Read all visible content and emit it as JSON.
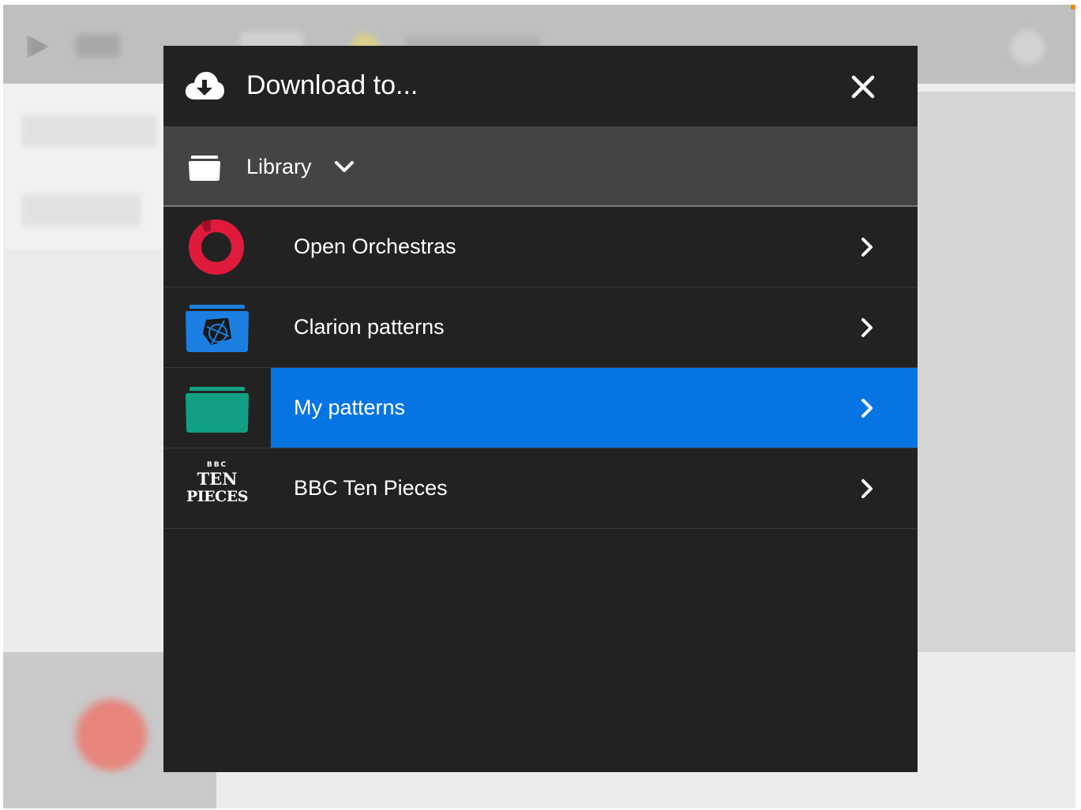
{
  "dialog": {
    "title": "Download to...",
    "header_icon": "cloud-download-icon",
    "close_icon": "close-icon",
    "location": {
      "label": "Library",
      "icon": "folder-icon",
      "dropdown_icon": "chevron-down-icon"
    },
    "items": [
      {
        "label": "Open Orchestras",
        "icon": "open-orchestras-logo",
        "selected": false
      },
      {
        "label": "Clarion patterns",
        "icon": "clarion-folder-icon",
        "selected": false
      },
      {
        "label": "My patterns",
        "icon": "green-folder-icon",
        "selected": true
      },
      {
        "label": "BBC Ten Pieces",
        "icon": "bbc-ten-pieces-logo",
        "selected": false,
        "logo_text": [
          "BBC",
          "TEN",
          "PIECES"
        ]
      }
    ]
  },
  "colors": {
    "dialog_bg": "#222222",
    "location_bar_bg": "#444444",
    "selected_bg": "#0774e3",
    "open_orchestras_red": "#e01a3c",
    "clarion_blue": "#1a7fe0",
    "my_patterns_green": "#12a085"
  }
}
